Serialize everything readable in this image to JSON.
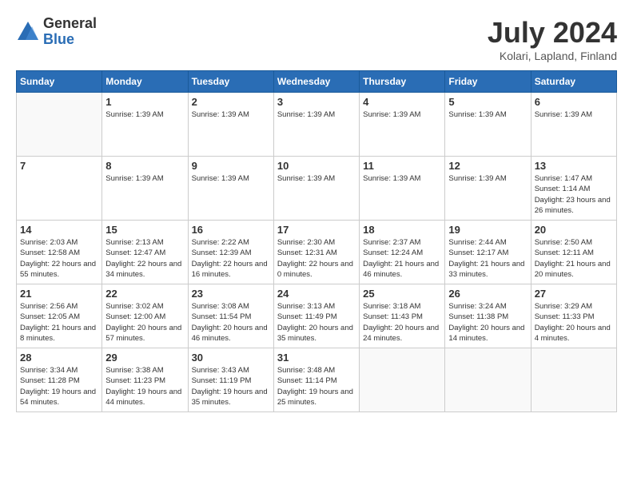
{
  "logo": {
    "general": "General",
    "blue": "Blue"
  },
  "title": "July 2024",
  "location": "Kolari, Lapland, Finland",
  "headers": [
    "Sunday",
    "Monday",
    "Tuesday",
    "Wednesday",
    "Thursday",
    "Friday",
    "Saturday"
  ],
  "weeks": [
    [
      {
        "day": "",
        "info": ""
      },
      {
        "day": "1",
        "info": "Sunrise: 1:39 AM"
      },
      {
        "day": "2",
        "info": "Sunrise: 1:39 AM"
      },
      {
        "day": "3",
        "info": "Sunrise: 1:39 AM"
      },
      {
        "day": "4",
        "info": "Sunrise: 1:39 AM"
      },
      {
        "day": "5",
        "info": "Sunrise: 1:39 AM"
      },
      {
        "day": "6",
        "info": "Sunrise: 1:39 AM"
      }
    ],
    [
      {
        "day": "7",
        "info": ""
      },
      {
        "day": "8",
        "info": "Sunrise: 1:39 AM"
      },
      {
        "day": "9",
        "info": "Sunrise: 1:39 AM"
      },
      {
        "day": "10",
        "info": "Sunrise: 1:39 AM"
      },
      {
        "day": "11",
        "info": "Sunrise: 1:39 AM"
      },
      {
        "day": "12",
        "info": "Sunrise: 1:39 AM"
      },
      {
        "day": "13",
        "info": "Sunrise: 1:47 AM\nSunset: 1:14 AM\nDaylight: 23 hours and 26 minutes."
      }
    ],
    [
      {
        "day": "14",
        "info": "Sunrise: 2:03 AM\nSunset: 12:58 AM\nDaylight: 22 hours and 55 minutes."
      },
      {
        "day": "15",
        "info": "Sunrise: 2:13 AM\nSunset: 12:47 AM\nDaylight: 22 hours and 34 minutes."
      },
      {
        "day": "16",
        "info": "Sunrise: 2:22 AM\nSunset: 12:39 AM\nDaylight: 22 hours and 16 minutes."
      },
      {
        "day": "17",
        "info": "Sunrise: 2:30 AM\nSunset: 12:31 AM\nDaylight: 22 hours and 0 minutes."
      },
      {
        "day": "18",
        "info": "Sunrise: 2:37 AM\nSunset: 12:24 AM\nDaylight: 21 hours and 46 minutes."
      },
      {
        "day": "19",
        "info": "Sunrise: 2:44 AM\nSunset: 12:17 AM\nDaylight: 21 hours and 33 minutes."
      },
      {
        "day": "20",
        "info": "Sunrise: 2:50 AM\nSunset: 12:11 AM\nDaylight: 21 hours and 20 minutes."
      }
    ],
    [
      {
        "day": "21",
        "info": "Sunrise: 2:56 AM\nSunset: 12:05 AM\nDaylight: 21 hours and 8 minutes."
      },
      {
        "day": "22",
        "info": "Sunrise: 3:02 AM\nSunset: 12:00 AM\nDaylight: 20 hours and 57 minutes."
      },
      {
        "day": "23",
        "info": "Sunrise: 3:08 AM\nSunset: 11:54 PM\nDaylight: 20 hours and 46 minutes."
      },
      {
        "day": "24",
        "info": "Sunrise: 3:13 AM\nSunset: 11:49 PM\nDaylight: 20 hours and 35 minutes."
      },
      {
        "day": "25",
        "info": "Sunrise: 3:18 AM\nSunset: 11:43 PM\nDaylight: 20 hours and 24 minutes."
      },
      {
        "day": "26",
        "info": "Sunrise: 3:24 AM\nSunset: 11:38 PM\nDaylight: 20 hours and 14 minutes."
      },
      {
        "day": "27",
        "info": "Sunrise: 3:29 AM\nSunset: 11:33 PM\nDaylight: 20 hours and 4 minutes."
      }
    ],
    [
      {
        "day": "28",
        "info": "Sunrise: 3:34 AM\nSunset: 11:28 PM\nDaylight: 19 hours and 54 minutes."
      },
      {
        "day": "29",
        "info": "Sunrise: 3:38 AM\nSunset: 11:23 PM\nDaylight: 19 hours and 44 minutes."
      },
      {
        "day": "30",
        "info": "Sunrise: 3:43 AM\nSunset: 11:19 PM\nDaylight: 19 hours and 35 minutes."
      },
      {
        "day": "31",
        "info": "Sunrise: 3:48 AM\nSunset: 11:14 PM\nDaylight: 19 hours and 25 minutes."
      },
      {
        "day": "",
        "info": ""
      },
      {
        "day": "",
        "info": ""
      },
      {
        "day": "",
        "info": ""
      }
    ]
  ]
}
